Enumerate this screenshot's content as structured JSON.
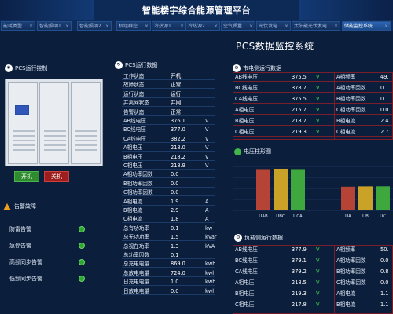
{
  "header": {
    "title": "智能楼宇综合能源管理平台"
  },
  "tabs": [
    {
      "label": "能耗类型"
    },
    {
      "label": "智能照明1"
    },
    {
      "label": "智能照明2"
    },
    {
      "label": "机组群控"
    },
    {
      "label": "冷热源1"
    },
    {
      "label": "冷热源2"
    },
    {
      "label": "空气质量"
    },
    {
      "label": "光伏发电"
    },
    {
      "label": "太阳能光伏发电"
    },
    {
      "label": "储能监控系统"
    }
  ],
  "page": {
    "title": "PCS数据监控系统"
  },
  "pcs_control": {
    "title": "PCS运行控制",
    "on_label": "开机",
    "off_label": "关机"
  },
  "alarms": {
    "title": "告警故障",
    "items": [
      {
        "label": "防雷告警",
        "color": "#2ea82e"
      },
      {
        "label": "急停告警",
        "color": "#2ea82e"
      },
      {
        "label": "高频同步告警",
        "color": "#2ea82e"
      },
      {
        "label": "低频同步告警",
        "color": "#2ea82e"
      }
    ]
  },
  "pcs_data": {
    "title": "PCS运行数据",
    "rows": [
      {
        "label": "工作状态",
        "value": "开机",
        "unit": ""
      },
      {
        "label": "故障状态",
        "value": "正常",
        "unit": ""
      },
      {
        "label": "运行状态",
        "value": "运行",
        "unit": ""
      },
      {
        "label": "并离网状态",
        "value": "并网",
        "unit": ""
      },
      {
        "label": "告警状态",
        "value": "正常",
        "unit": ""
      },
      {
        "label": "AB线电压",
        "value": "376.1",
        "unit": "V"
      },
      {
        "label": "BC线电压",
        "value": "377.0",
        "unit": "V"
      },
      {
        "label": "CA线电压",
        "value": "382.2",
        "unit": "V"
      },
      {
        "label": "A相电压",
        "value": "218.0",
        "unit": "V"
      },
      {
        "label": "B相电压",
        "value": "218.2",
        "unit": "V"
      },
      {
        "label": "C相电压",
        "value": "218.9",
        "unit": "V"
      },
      {
        "label": "A相功率因数",
        "value": "0.0",
        "unit": ""
      },
      {
        "label": "B相功率因数",
        "value": "0.0",
        "unit": ""
      },
      {
        "label": "C相功率因数",
        "value": "0.0",
        "unit": ""
      },
      {
        "label": "A相电流",
        "value": "1.9",
        "unit": "A"
      },
      {
        "label": "B相电流",
        "value": "2.9",
        "unit": "A"
      },
      {
        "label": "C相电流",
        "value": "1.8",
        "unit": "A"
      },
      {
        "label": "总有功功率",
        "value": "0.1",
        "unit": "kw"
      },
      {
        "label": "总无功功率",
        "value": "1.5",
        "unit": "kVar"
      },
      {
        "label": "总视在功率",
        "value": "1.3",
        "unit": "kVA"
      },
      {
        "label": "总功率因数",
        "value": "0.1",
        "unit": ""
      },
      {
        "label": "总充电电量",
        "value": "869.0",
        "unit": "kwh"
      },
      {
        "label": "总放电电量",
        "value": "724.0",
        "unit": "kwh"
      },
      {
        "label": "日充电电量",
        "value": "1.0",
        "unit": "kwh"
      },
      {
        "label": "日放电电量",
        "value": "0.0",
        "unit": "kwh"
      }
    ]
  },
  "grid_data": {
    "title": "市电侧运行数据",
    "left": [
      {
        "label": "AB线电压",
        "value": "375.5",
        "unit": "V"
      },
      {
        "label": "BC线电压",
        "value": "378.7",
        "unit": "V"
      },
      {
        "label": "CA线电压",
        "value": "375.5",
        "unit": "V"
      },
      {
        "label": "A相电压",
        "value": "215.7",
        "unit": "V"
      },
      {
        "label": "B相电压",
        "value": "218.7",
        "unit": "V"
      },
      {
        "label": "C相电压",
        "value": "219.3",
        "unit": "V"
      }
    ],
    "right": [
      {
        "label": "A相频率",
        "value": "49."
      },
      {
        "label": "A相功率因数",
        "value": "0.1"
      },
      {
        "label": "B相功率因数",
        "value": "0.1"
      },
      {
        "label": "C相功率因数",
        "value": "0.0"
      },
      {
        "label": "B相电流",
        "value": "2.4"
      },
      {
        "label": "C相电流",
        "value": "2.7"
      }
    ]
  },
  "voltage_chart": {
    "title": "电压柱形图",
    "chart_data": {
      "type": "bar",
      "series": [
        {
          "categories": [
            "UAB",
            "UBC",
            "UCA"
          ],
          "values": [
            375.5,
            378.7,
            375.5
          ],
          "colors": [
            "#b54436",
            "#c9a227",
            "#3ea83e"
          ]
        },
        {
          "categories": [
            "UA",
            "UB",
            "UC"
          ],
          "values": [
            215.7,
            218.7,
            219.3
          ],
          "colors": [
            "#b54436",
            "#c9a227",
            "#3ea83e"
          ]
        }
      ],
      "grid": true
    }
  },
  "load_data": {
    "title": "负载侧运行数据",
    "left": [
      {
        "label": "AB线电压",
        "value": "377.9",
        "unit": "V"
      },
      {
        "label": "BC线电压",
        "value": "379.1",
        "unit": "V"
      },
      {
        "label": "CA线电压",
        "value": "379.2",
        "unit": "V"
      },
      {
        "label": "A相电压",
        "value": "218.5",
        "unit": "V"
      },
      {
        "label": "B相电压",
        "value": "219.3",
        "unit": "V"
      },
      {
        "label": "C相电压",
        "value": "217.8",
        "unit": "V"
      }
    ],
    "right": [
      {
        "label": "A相频率",
        "value": "50."
      },
      {
        "label": "A相功率因数",
        "value": "0.0"
      },
      {
        "label": "B相功率因数",
        "value": "0.8"
      },
      {
        "label": "C相功率因数",
        "value": "0.0"
      },
      {
        "label": "A相电流",
        "value": "1.1"
      },
      {
        "label": "B相电流",
        "value": "1.1"
      }
    ]
  }
}
